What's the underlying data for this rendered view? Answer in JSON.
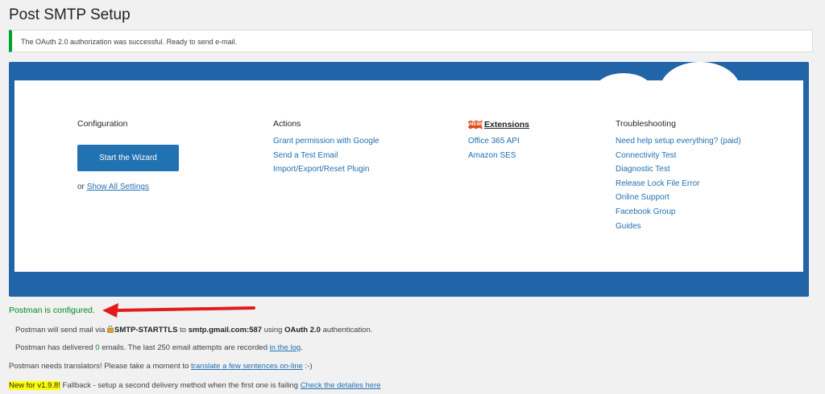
{
  "page": {
    "title": "Post SMTP Setup"
  },
  "notice": {
    "text": "The OAuth 2.0 authorization was successful. Ready to send e-mail."
  },
  "colors": {
    "accent": "#2271b1",
    "panel_blue": "#2165a8",
    "success_green": "#008a20",
    "arrow_red": "#e21b1b",
    "highlight_yellow": "#ffff00"
  },
  "configuration": {
    "heading": "Configuration",
    "wizard_button": "Start the Wizard",
    "or_prefix": "or",
    "show_all_settings": "Show All Settings"
  },
  "actions": {
    "heading": "Actions",
    "links": [
      "Grant permission with Google",
      "Send a Test Email",
      "Import/Export/Reset Plugin"
    ]
  },
  "extensions": {
    "badge": "NEW",
    "heading": "Extensions",
    "links": [
      "Office 365 API",
      "Amazon SES"
    ]
  },
  "troubleshooting": {
    "heading": "Troubleshooting",
    "links": [
      "Need help setup everything? (paid)",
      "Connectivity Test",
      "Diagnostic Test",
      "Release Lock File Error",
      "Online Support",
      "Facebook Group",
      "Guides"
    ]
  },
  "status": {
    "configured": "Postman is configured.",
    "send_via_prefix": "Postman will send mail via",
    "transport": "SMTP-STARTTLS",
    "to_word": "to",
    "server": "smtp.gmail.com:587",
    "using_word": "using",
    "auth": "OAuth 2.0",
    "auth_suffix": "authentication.",
    "delivered_prefix": "Postman has delivered",
    "delivered_count": "0",
    "delivered_suffix": "emails. The last 250 email attempts are recorded",
    "log_link": "in the log",
    "period": ".",
    "translators_prefix": "Postman needs translators! Please take a moment to",
    "translators_link": "translate a few sentences on-line",
    "translators_suffix": ":-)",
    "new_badge": "New for v1.9.8!",
    "fallback_text": "Fallback - setup a second delivery method when the first one is failing",
    "fallback_link": "Check the detailes here"
  }
}
